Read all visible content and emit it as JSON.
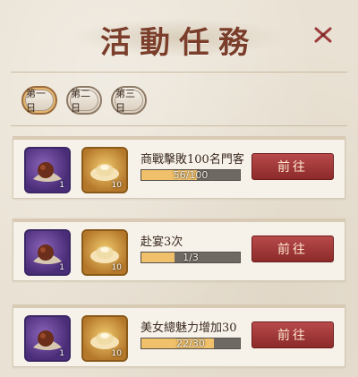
{
  "title": "活動任務",
  "colors": {
    "accent": "#7a3e2a",
    "button": "#8c2a2a",
    "progress": "#f0c06a"
  },
  "icons": {
    "close": "close-x-icon",
    "reward_a": "roasted-meat-icon",
    "reward_b": "gold-ingot-icon"
  },
  "day_tabs": [
    {
      "label": "第一日",
      "active": true
    },
    {
      "label": "第二日",
      "active": false
    },
    {
      "label": "第三日",
      "active": false
    }
  ],
  "tasks": [
    {
      "text": "商戰擊敗100名門客",
      "progress": "56/100",
      "progress_value": 56,
      "progress_max": 100,
      "rewards": [
        {
          "icon": "roasted-meat-icon",
          "count": "1"
        },
        {
          "icon": "gold-ingot-icon",
          "count": "10"
        }
      ],
      "button": "前往"
    },
    {
      "text": "赴宴3次",
      "progress": "1/3",
      "progress_value": 1,
      "progress_max": 3,
      "rewards": [
        {
          "icon": "roasted-meat-icon",
          "count": "1"
        },
        {
          "icon": "gold-ingot-icon",
          "count": "10"
        }
      ],
      "button": "前往"
    },
    {
      "text": "美女總魅力增加30",
      "progress": "22/30",
      "progress_value": 22,
      "progress_max": 30,
      "rewards": [
        {
          "icon": "roasted-meat-icon",
          "count": "1"
        },
        {
          "icon": "gold-ingot-icon",
          "count": "10"
        }
      ],
      "button": "前往"
    }
  ]
}
